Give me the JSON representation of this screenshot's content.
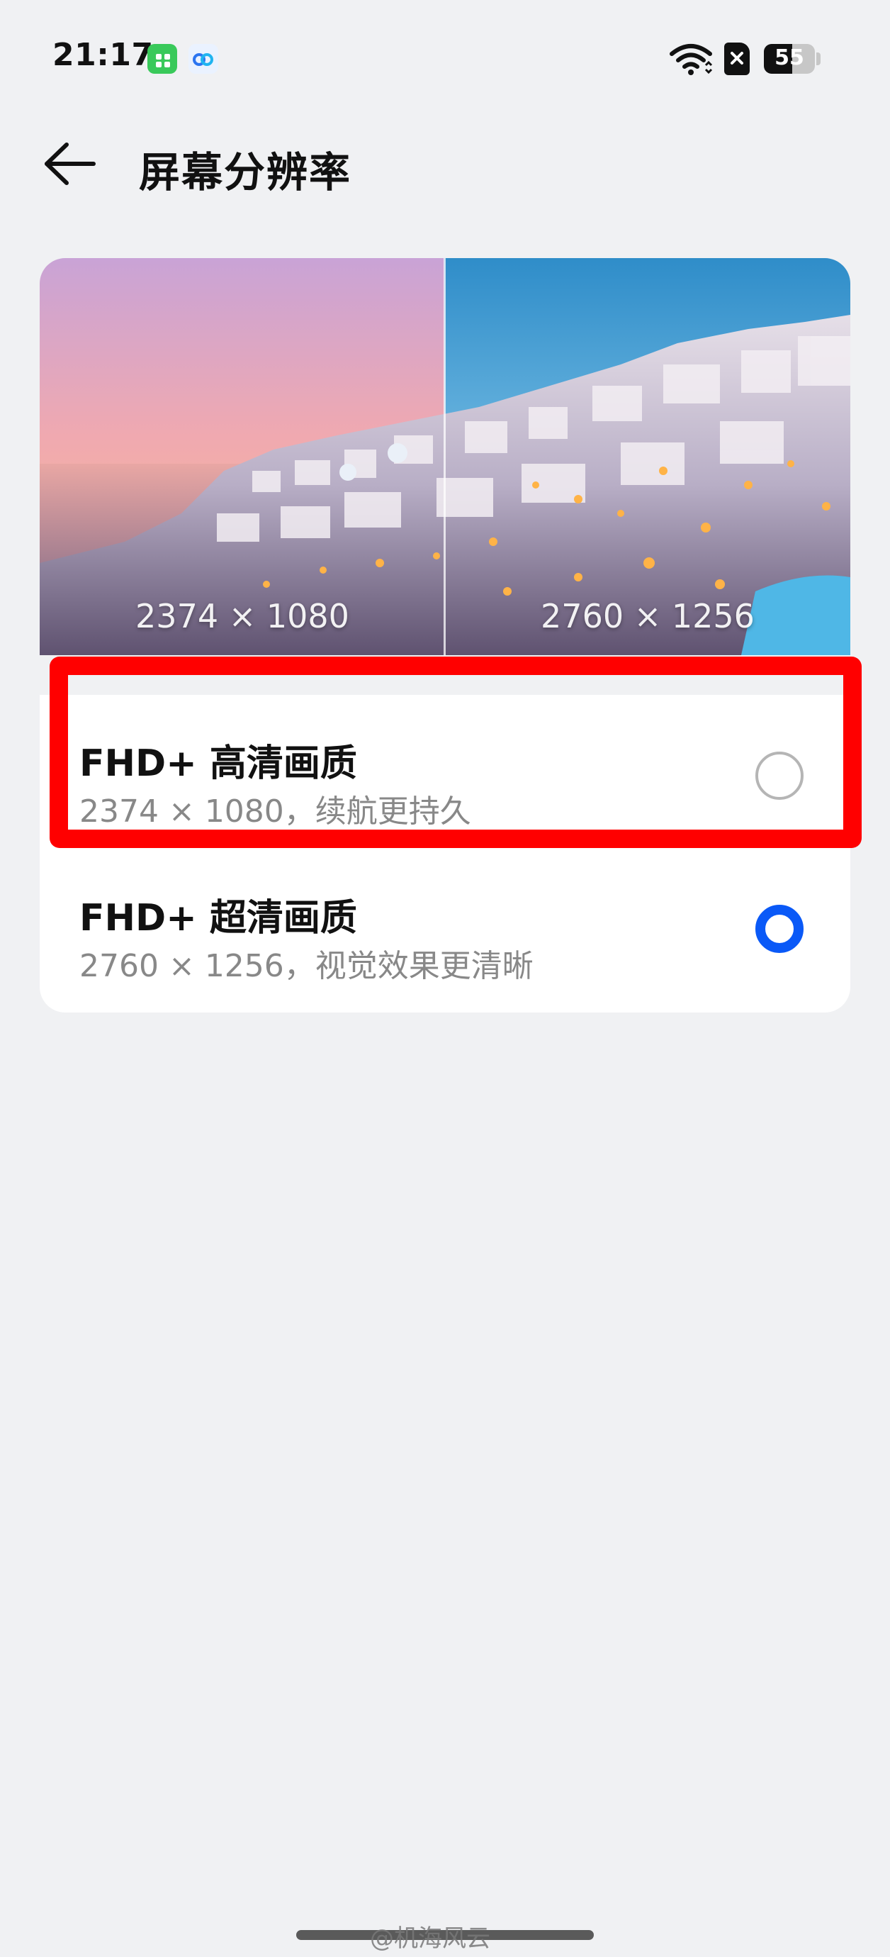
{
  "status_bar": {
    "time": "21:17",
    "battery_level": "55",
    "battery_fraction": 0.55,
    "icons": [
      "app-green-icon",
      "cloud-app-icon",
      "wifi-icon",
      "sim-icon",
      "battery-icon"
    ]
  },
  "header": {
    "back_icon": "back-arrow-icon",
    "title": "屏幕分辨率"
  },
  "preview": {
    "left_label": "2374 × 1080",
    "right_label": "2760 × 1256"
  },
  "options": [
    {
      "title": "FHD+ 高清画质",
      "subtitle": "2374 × 1080，续航更持久",
      "selected": false
    },
    {
      "title": "FHD+ 超清画质",
      "subtitle": "2760 × 1256，视觉效果更清晰",
      "selected": true
    }
  ],
  "colors": {
    "accent": "#0a59f7",
    "highlight": "#ff0000",
    "background": "#f0f1f3"
  },
  "watermark": "@机海风云"
}
